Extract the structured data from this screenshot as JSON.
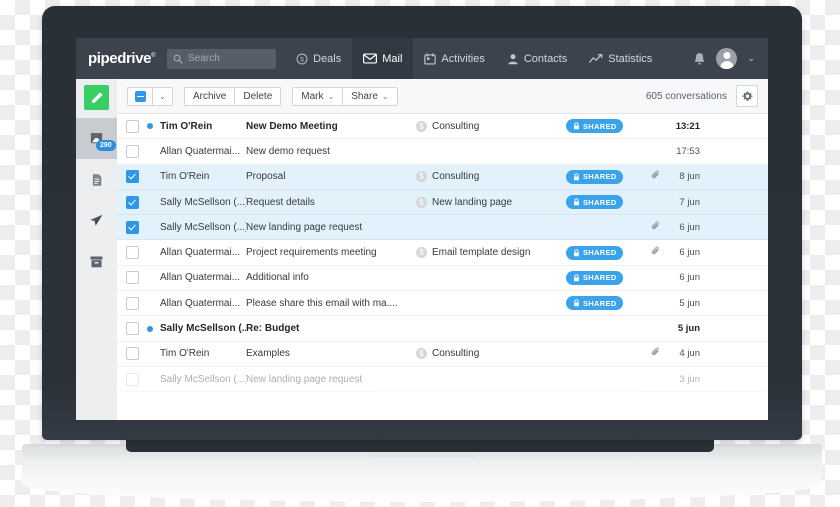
{
  "app": {
    "logo": "pipedrive",
    "logo_mark": "®"
  },
  "nav": {
    "search_placeholder": "Search",
    "search_icon": "search-icon",
    "items": [
      {
        "label": "Deals",
        "icon": "deal-dollar-icon",
        "active": false
      },
      {
        "label": "Mail",
        "icon": "envelope-icon",
        "active": true
      },
      {
        "label": "Activities",
        "icon": "calendar-icon",
        "active": false
      },
      {
        "label": "Contacts",
        "icon": "person-icon",
        "active": false
      },
      {
        "label": "Statistics",
        "icon": "trend-line-icon",
        "active": false
      }
    ],
    "bell_icon": "bell-icon",
    "avatar_icon": "avatar-icon",
    "caret": "⌄"
  },
  "rail": {
    "compose_icon": "pencil-compose-icon",
    "items": [
      {
        "icon": "inbox-icon",
        "badge": "290",
        "active": true
      },
      {
        "icon": "drafts-document-icon",
        "badge": "",
        "active": false
      },
      {
        "icon": "sent-paper-plane-icon",
        "badge": "",
        "active": false
      },
      {
        "icon": "archive-box-icon",
        "badge": "",
        "active": false
      }
    ]
  },
  "toolbar": {
    "select_all_state": "indeterminate",
    "select_caret": "⌄",
    "archive_label": "Archive",
    "delete_label": "Delete",
    "mark_label": "Mark",
    "mark_caret": "⌄",
    "share_label": "Share",
    "share_caret": "⌄",
    "conversation_count": "605 conversations",
    "settings_icon": "gear-icon"
  },
  "colors": {
    "nav_bg": "#3c434c",
    "accent_blue": "#2f96e8",
    "pill_blue": "#3ba3ea",
    "compose_green": "#39ce63",
    "row_selected_bg": "#e3f1fb"
  },
  "list": {
    "shared_label": "SHARED",
    "lock_icon": "lock-icon",
    "attachment_icon": "paperclip-icon",
    "rows": [
      {
        "checked": false,
        "unread": true,
        "sender": "Tim O'Rein",
        "subject": "New Demo Meeting",
        "deal": "Consulting",
        "shared": true,
        "attachment": false,
        "time": "13:21",
        "selected": false,
        "faded": false
      },
      {
        "checked": false,
        "unread": false,
        "sender": "Allan Quatermai...",
        "subject": "New demo request",
        "deal": "",
        "shared": false,
        "attachment": false,
        "time": "17:53",
        "selected": false,
        "faded": false
      },
      {
        "checked": true,
        "unread": false,
        "sender": "Tim O'Rein",
        "subject": "Proposal",
        "deal": "Consulting",
        "shared": true,
        "attachment": true,
        "time": "8 jun",
        "selected": true,
        "faded": false
      },
      {
        "checked": true,
        "unread": false,
        "sender": "Sally McSellson (...)",
        "subject": "Request details",
        "deal": "New landing page",
        "shared": true,
        "attachment": false,
        "time": "7 jun",
        "selected": true,
        "faded": false
      },
      {
        "checked": true,
        "unread": false,
        "sender": "Sally McSellson (...)",
        "subject": "New landing page request",
        "deal": "",
        "shared": false,
        "attachment": true,
        "time": "6 jun",
        "selected": true,
        "faded": false
      },
      {
        "checked": false,
        "unread": false,
        "sender": "Allan Quatermai...",
        "subject": "Project requirements meeting",
        "deal": "Email template design",
        "shared": true,
        "attachment": true,
        "time": "6 jun",
        "selected": false,
        "faded": false
      },
      {
        "checked": false,
        "unread": false,
        "sender": "Allan Quatermai...",
        "subject": "Additional info",
        "deal": "",
        "shared": true,
        "attachment": false,
        "time": "6 jun",
        "selected": false,
        "faded": false
      },
      {
        "checked": false,
        "unread": false,
        "sender": "Allan Quatermai...",
        "subject": "Please share this email with ma....",
        "deal": "",
        "shared": true,
        "attachment": false,
        "time": "5 jun",
        "selected": false,
        "faded": false
      },
      {
        "checked": false,
        "unread": true,
        "sender": "Sally McSellson (...)",
        "subject": "Re: Budget",
        "deal": "",
        "shared": false,
        "attachment": false,
        "time": "5 jun",
        "selected": false,
        "faded": false
      },
      {
        "checked": false,
        "unread": false,
        "sender": "Tim O'Rein",
        "subject": "Examples",
        "deal": "Consulting",
        "shared": false,
        "attachment": true,
        "time": "4 jun",
        "selected": false,
        "faded": false
      },
      {
        "checked": false,
        "unread": false,
        "sender": "Sally McSellson (...)",
        "subject": "New landing page request",
        "deal": "",
        "shared": false,
        "attachment": false,
        "time": "3 jun",
        "selected": false,
        "faded": true
      }
    ]
  }
}
